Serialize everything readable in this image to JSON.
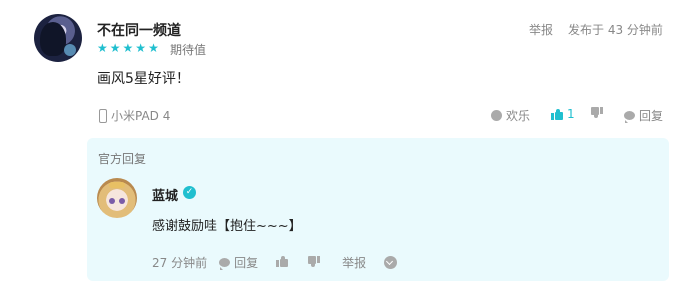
{
  "review": {
    "username": "不在同一频道",
    "stars": 5,
    "rating_label": "期待值",
    "report": "举报",
    "posted": "发布于 43 分钟前",
    "text": "画风5星好评！",
    "device": "小米PAD 4",
    "actions": {
      "fun_label": "欢乐",
      "like_count": "1",
      "reply_label": "回复"
    }
  },
  "official_reply": {
    "title": "官方回复",
    "name": "蓝城",
    "text": "感谢鼓励哇【抱住~~~】",
    "time": "27 分钟前",
    "reply_label": "回复",
    "report": "举报"
  },
  "colors": {
    "accent": "#20bfcf",
    "reply_bg": "#eafafd",
    "muted_text": "#888888"
  }
}
